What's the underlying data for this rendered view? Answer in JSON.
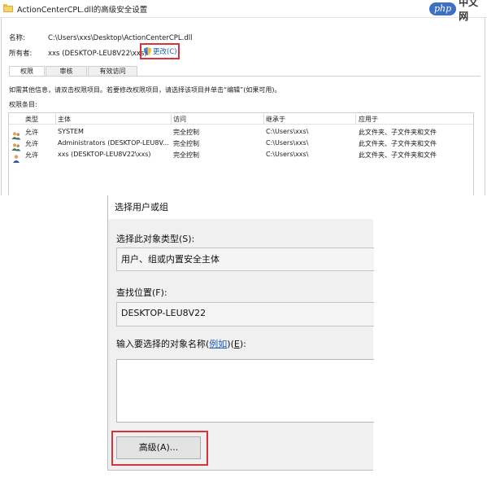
{
  "top_window": {
    "title": "ActionCenterCPL.dll的高级安全设置",
    "brand": {
      "badge": "php",
      "text": "中文网"
    },
    "name_label": "名称:",
    "name_value": "C:\\Users\\xxs\\Desktop\\ActionCenterCPL.dll",
    "owner_label": "所有者:",
    "owner_value": "xxs (DESKTOP-LEU8V22\\xxs)",
    "change_link": "更改(C)",
    "tabs": [
      {
        "label": "权限",
        "active": true
      },
      {
        "label": "审核",
        "active": false
      },
      {
        "label": "有效访问",
        "active": false
      }
    ],
    "hint": "如需其他信息，请双击权限项目。若要修改权限项目，请选择该项目并单击“编辑”(如果可用)。",
    "entries_label": "权限条目:",
    "table": {
      "headers": [
        "类型",
        "主体",
        "访问",
        "继承于",
        "应用于"
      ],
      "rows": [
        {
          "icon": "group-users-icon",
          "type": "允许",
          "principal": "SYSTEM",
          "access": "完全控制",
          "inherited_from": "C:\\Users\\xxs\\",
          "applies_to": "此文件夹、子文件夹和文件"
        },
        {
          "icon": "group-users-icon",
          "type": "允许",
          "principal": "Administrators (DESKTOP-LEU8V...",
          "access": "完全控制",
          "inherited_from": "C:\\Users\\xxs\\",
          "applies_to": "此文件夹、子文件夹和文件"
        },
        {
          "icon": "user-icon",
          "type": "允许",
          "principal": "xxs (DESKTOP-LEU8V22\\xxs)",
          "access": "完全控制",
          "inherited_from": "C:\\Users\\xxs\\",
          "applies_to": "此文件夹、子文件夹和文件"
        }
      ]
    }
  },
  "select_dialog": {
    "title": "选择用户或组",
    "object_type_label": "选择此对象类型(S):",
    "object_type_value": "用户、组或内置安全主体",
    "location_label": "查找位置(F):",
    "location_value": "DESKTOP-LEU8V22",
    "names_label_prefix": "输入要选择的对象名称(",
    "names_label_link": "例如",
    "names_label_mid": ")(",
    "names_label_key": "E",
    "names_label_suffix": "):",
    "names_value": "",
    "advanced_button": "高级(A)..."
  },
  "colors": {
    "highlight": "#d9323a",
    "link": "#1a5fb4",
    "dialog_bg": "#f0f0f0"
  }
}
